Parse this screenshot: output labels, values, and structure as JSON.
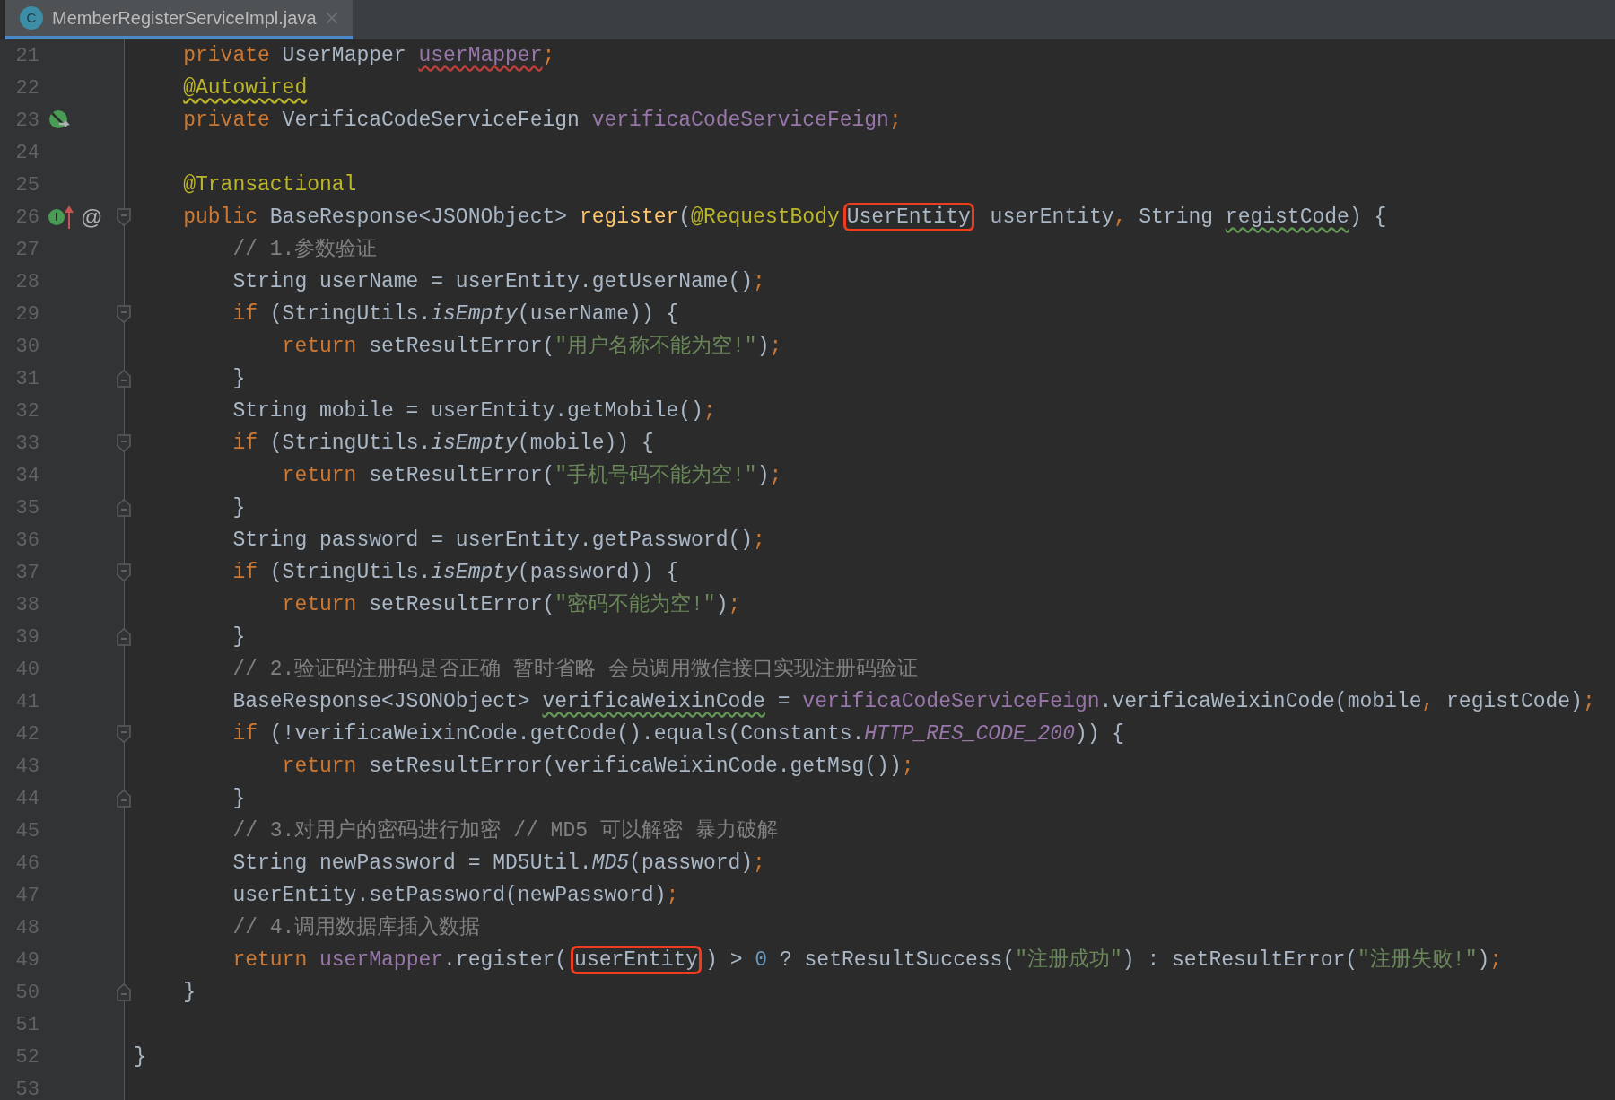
{
  "tab": {
    "icon_letter": "C",
    "title": "MemberRegisterServiceImpl.java",
    "selected": true
  },
  "lines": [
    {
      "children": [
        {
          "number": "21",
          "tokens": [
            {
              "text": "private",
              "kind": "kw"
            },
            {
              "text": " UserMapper ",
              "kind": "p"
            },
            {
              "text": "userMapper",
              "kind": "field",
              "error_underline": true
            },
            {
              "text": ";",
              "kind": "kw"
            }
          ]
        },
        {
          "number": "22",
          "tokens": [
            {
              "text": "@Autowired",
              "kind": "ann",
              "warning_underline": true
            }
          ]
        },
        {
          "number": "23",
          "gutter": [
            {
              "kind": "bean"
            }
          ],
          "tokens": [
            {
              "text": "private",
              "kind": "kw"
            },
            {
              "text": " VerificaCodeServiceFeign ",
              "kind": "p"
            },
            {
              "text": "verificaCodeServiceFeign",
              "kind": "field"
            },
            {
              "text": ";",
              "kind": "kw"
            }
          ]
        },
        {
          "number": "24"
        },
        {
          "number": "25",
          "tokens": [
            {
              "text": "@Transactional",
              "kind": "ann"
            }
          ]
        },
        {
          "number": "26",
          "fold_start": true,
          "gutter": [
            {
              "kind": "implements",
              "text": "I"
            },
            {
              "kind": "glyph",
              "text": "@"
            }
          ],
          "tokens": [
            {
              "text": "public",
              "kind": "kw"
            },
            {
              "text": " BaseResponse<JSONObject> ",
              "kind": "p"
            },
            {
              "text": "register",
              "kind": "decl"
            },
            {
              "text": "(",
              "kind": "p"
            },
            {
              "text": "@RequestBody",
              "kind": "ann"
            },
            {
              "text": "UserEntity",
              "kind": "p",
              "boxed": true
            },
            {
              "text": " userEntity",
              "kind": "p"
            },
            {
              "text": ",",
              "kind": "kw"
            },
            {
              "text": " String ",
              "kind": "p"
            },
            {
              "text": "registCode",
              "kind": "p",
              "typo_underline": true
            },
            {
              "text": ") {",
              "kind": "p"
            }
          ],
          "children": [
            {
              "number": "27",
              "tokens": [
                {
                  "text": "// 1.参数验证",
                  "kind": "cmt"
                }
              ]
            },
            {
              "number": "28",
              "tokens": [
                {
                  "text": "String userName = userEntity.getUserName()",
                  "kind": "p"
                },
                {
                  "text": ";",
                  "kind": "kw"
                }
              ]
            },
            {
              "number": "29",
              "fold_start": true,
              "tokens": [
                {
                  "text": "if",
                  "kind": "kw"
                },
                {
                  "text": " (StringUtils.",
                  "kind": "p"
                },
                {
                  "text": "isEmpty",
                  "kind": "static"
                },
                {
                  "text": "(userName)) {",
                  "kind": "p"
                }
              ],
              "children": [
                {
                  "number": "30",
                  "tokens": [
                    {
                      "text": "return",
                      "kind": "kw"
                    },
                    {
                      "text": " setResultError(",
                      "kind": "p"
                    },
                    {
                      "text": "\"用户名称不能为空!\"",
                      "kind": "str"
                    },
                    {
                      "text": ")",
                      "kind": "p"
                    },
                    {
                      "text": ";",
                      "kind": "kw"
                    }
                  ]
                }
              ]
            },
            {
              "number": "31",
              "fold_end": true,
              "tokens": [
                {
                  "text": "}",
                  "kind": "p"
                }
              ]
            },
            {
              "number": "32",
              "tokens": [
                {
                  "text": "String mobile = userEntity.getMobile()",
                  "kind": "p"
                },
                {
                  "text": ";",
                  "kind": "kw"
                }
              ]
            },
            {
              "number": "33",
              "fold_start": true,
              "tokens": [
                {
                  "text": "if",
                  "kind": "kw"
                },
                {
                  "text": " (StringUtils.",
                  "kind": "p"
                },
                {
                  "text": "isEmpty",
                  "kind": "static"
                },
                {
                  "text": "(mobile)) {",
                  "kind": "p"
                }
              ],
              "children": [
                {
                  "number": "34",
                  "tokens": [
                    {
                      "text": "return",
                      "kind": "kw"
                    },
                    {
                      "text": " setResultError(",
                      "kind": "p"
                    },
                    {
                      "text": "\"手机号码不能为空!\"",
                      "kind": "str"
                    },
                    {
                      "text": ")",
                      "kind": "p"
                    },
                    {
                      "text": ";",
                      "kind": "kw"
                    }
                  ]
                }
              ]
            },
            {
              "number": "35",
              "fold_end": true,
              "tokens": [
                {
                  "text": "}",
                  "kind": "p"
                }
              ]
            },
            {
              "number": "36",
              "tokens": [
                {
                  "text": "String password = userEntity.getPassword()",
                  "kind": "p"
                },
                {
                  "text": ";",
                  "kind": "kw"
                }
              ]
            },
            {
              "number": "37",
              "fold_start": true,
              "tokens": [
                {
                  "text": "if",
                  "kind": "kw"
                },
                {
                  "text": " (StringUtils.",
                  "kind": "p"
                },
                {
                  "text": "isEmpty",
                  "kind": "static"
                },
                {
                  "text": "(password)) {",
                  "kind": "p"
                }
              ],
              "children": [
                {
                  "number": "38",
                  "tokens": [
                    {
                      "text": "return",
                      "kind": "kw"
                    },
                    {
                      "text": " setResultError(",
                      "kind": "p"
                    },
                    {
                      "text": "\"密码不能为空!\"",
                      "kind": "str"
                    },
                    {
                      "text": ")",
                      "kind": "p"
                    },
                    {
                      "text": ";",
                      "kind": "kw"
                    }
                  ]
                }
              ]
            },
            {
              "number": "39",
              "fold_end": true,
              "tokens": [
                {
                  "text": "}",
                  "kind": "p"
                }
              ]
            },
            {
              "number": "40",
              "tokens": [
                {
                  "text": "// 2.验证码注册码是否正确 暂时省略 会员调用微信接口实现注册码验证",
                  "kind": "cmt"
                }
              ]
            },
            {
              "number": "41",
              "tokens": [
                {
                  "text": "BaseResponse<JSONObject> ",
                  "kind": "p"
                },
                {
                  "text": "verificaWeixinCode",
                  "kind": "p",
                  "typo_underline": true
                },
                {
                  "text": " = ",
                  "kind": "p"
                },
                {
                  "text": "verificaCodeServiceFeign",
                  "kind": "field"
                },
                {
                  "text": ".verificaWeixinCode(mobile",
                  "kind": "p"
                },
                {
                  "text": ",",
                  "kind": "kw"
                },
                {
                  "text": " registCode)",
                  "kind": "p"
                },
                {
                  "text": ";",
                  "kind": "kw"
                }
              ]
            },
            {
              "number": "42",
              "fold_start": true,
              "tokens": [
                {
                  "text": "if",
                  "kind": "kw"
                },
                {
                  "text": " (!verificaWeixinCode.getCode().equals(Constants.",
                  "kind": "p"
                },
                {
                  "text": "HTTP_RES_CODE_200",
                  "kind": "const"
                },
                {
                  "text": ")) {",
                  "kind": "p"
                }
              ],
              "children": [
                {
                  "number": "43",
                  "tokens": [
                    {
                      "text": "return",
                      "kind": "kw"
                    },
                    {
                      "text": " setResultError(verificaWeixinCode.getMsg())",
                      "kind": "p"
                    },
                    {
                      "text": ";",
                      "kind": "kw"
                    }
                  ]
                }
              ]
            },
            {
              "number": "44",
              "fold_end": true,
              "tokens": [
                {
                  "text": "}",
                  "kind": "p"
                }
              ]
            },
            {
              "number": "45",
              "tokens": [
                {
                  "text": "// 3.对用户的密码进行加密 // MD5 可以解密 暴力破解",
                  "kind": "cmt"
                }
              ]
            },
            {
              "number": "46",
              "tokens": [
                {
                  "text": "String newPassword = MD5Util.",
                  "kind": "p"
                },
                {
                  "text": "MD5",
                  "kind": "static"
                },
                {
                  "text": "(password)",
                  "kind": "p"
                },
                {
                  "text": ";",
                  "kind": "kw"
                }
              ]
            },
            {
              "number": "47",
              "tokens": [
                {
                  "text": "userEntity.setPassword(newPassword)",
                  "kind": "p"
                },
                {
                  "text": ";",
                  "kind": "kw"
                }
              ]
            },
            {
              "number": "48",
              "tokens": [
                {
                  "text": "// 4.调用数据库插入数据",
                  "kind": "cmt"
                }
              ]
            },
            {
              "number": "49",
              "tokens": [
                {
                  "text": "return ",
                  "kind": "kw"
                },
                {
                  "text": "userMapper",
                  "kind": "field"
                },
                {
                  "text": ".register(",
                  "kind": "p"
                },
                {
                  "text": "userEntity",
                  "kind": "p",
                  "boxed": true
                },
                {
                  "text": ") > ",
                  "kind": "p"
                },
                {
                  "text": "0",
                  "kind": "num"
                },
                {
                  "text": " ? setResultSuccess(",
                  "kind": "p"
                },
                {
                  "text": "\"注册成功\"",
                  "kind": "str"
                },
                {
                  "text": ") : setResultError(",
                  "kind": "p"
                },
                {
                  "text": "\"注册失败!\"",
                  "kind": "str"
                },
                {
                  "text": ")",
                  "kind": "p"
                },
                {
                  "text": ";",
                  "kind": "kw"
                }
              ]
            }
          ]
        },
        {
          "number": "50",
          "fold_end": true,
          "tokens": [
            {
              "text": "}",
              "kind": "p"
            }
          ]
        }
      ]
    },
    {
      "number": "51"
    },
    {
      "number": "52",
      "tokens": [
        {
          "text": "}",
          "kind": "p"
        }
      ]
    },
    {
      "number": "53"
    }
  ]
}
